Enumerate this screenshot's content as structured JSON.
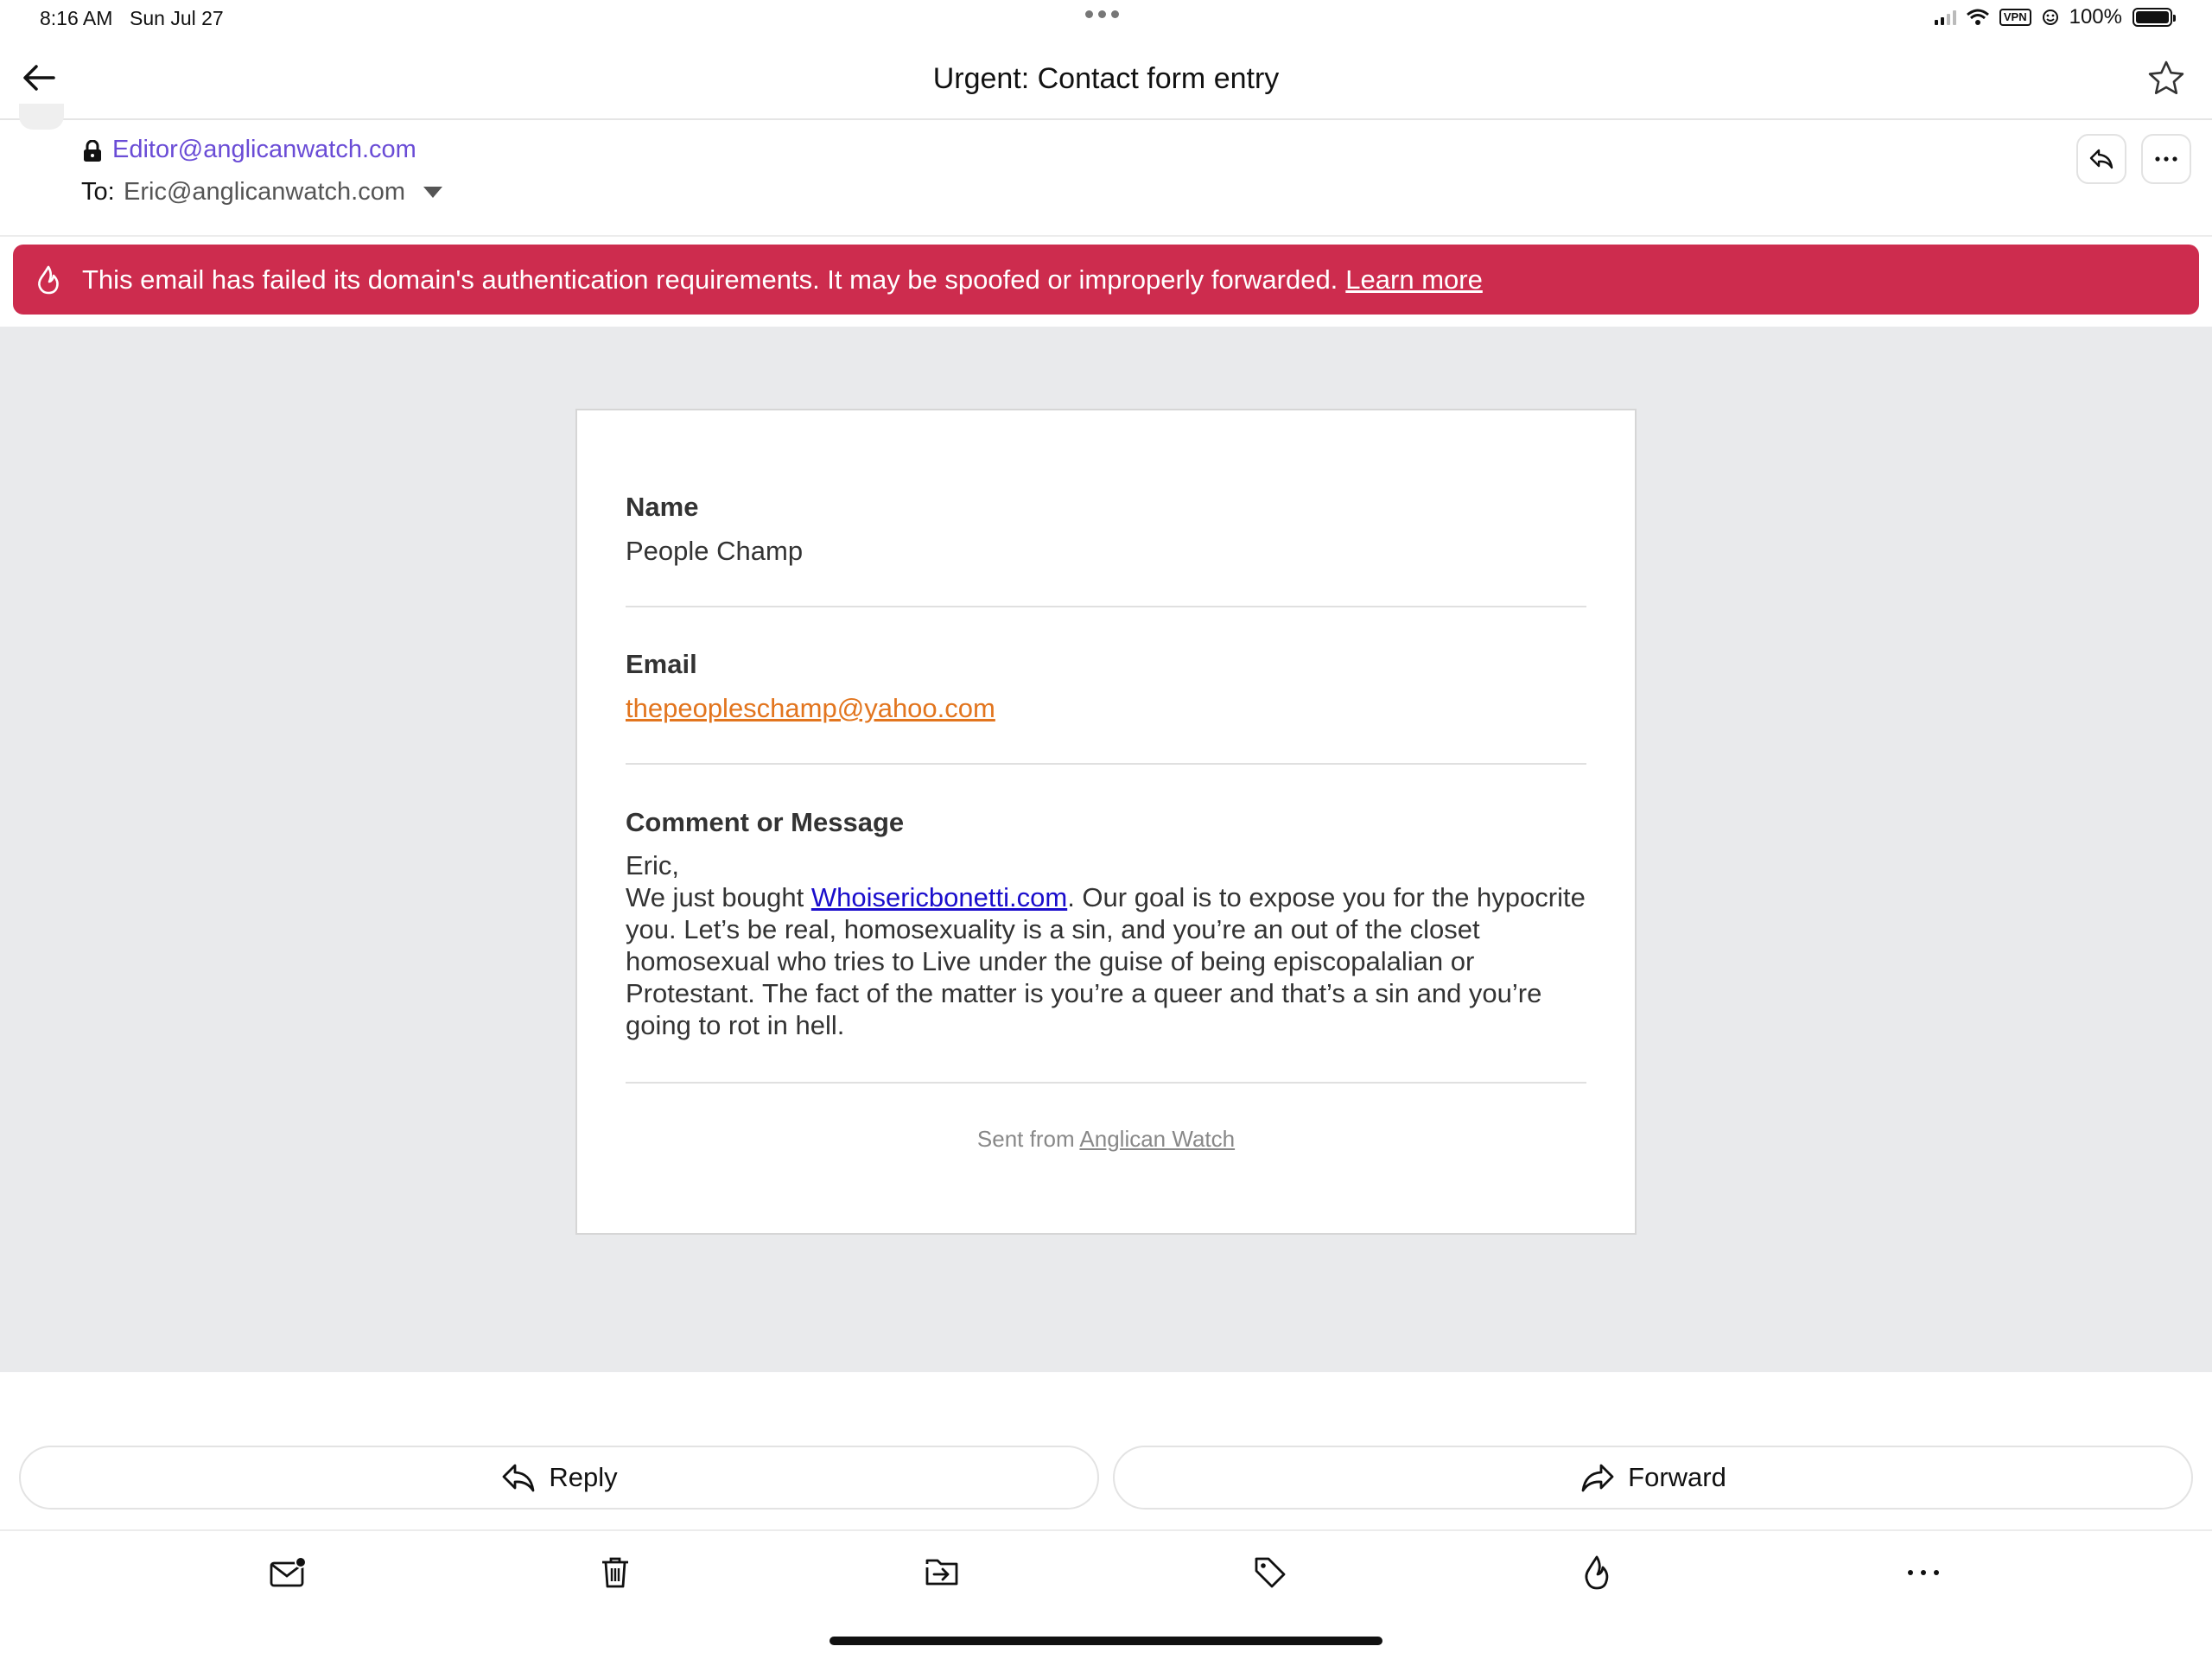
{
  "status_bar": {
    "time": "8:16 AM",
    "date": "Sun Jul 27",
    "vpn": "VPN",
    "battery": "100%"
  },
  "nav": {
    "subject": "Urgent: Contact form entry",
    "back_icon": "arrow-left-icon",
    "star_icon": "star-icon"
  },
  "header": {
    "from": "Editor@anglicanwatch.com",
    "to_label": "To:",
    "to": "Eric@anglicanwatch.com"
  },
  "warning": {
    "text": "This email has failed its domain's authentication requirements. It may be spoofed or improperly forwarded.",
    "link": "Learn more",
    "color": "#cd2c4e"
  },
  "form": {
    "name_label": "Name",
    "name_value": "People Champ",
    "email_label": "Email",
    "email_value": "thepeopleschamp@yahoo.com",
    "message_label": "Comment or Message",
    "message_greeting": "Eric,",
    "message_before_link": "We just bought ",
    "message_link": "Whoisericbonetti.com",
    "message_after_link": ". Our goal is to expose you for the hypocrite you. Let’s be real, homosexuality is a sin, and you’re an out of the closet homosexual who tries to Live under the guise of being episcopalalian or Protestant. The fact of the matter is you’re a queer and that’s a sin and you’re going to rot in hell.",
    "sent_from_prefix": "Sent from ",
    "sent_from_link": "Anglican Watch"
  },
  "actions": {
    "reply": "Reply",
    "forward": "Forward"
  },
  "colors": {
    "from_link": "#6a4cd6",
    "email_link": "#e2751e",
    "message_link": "#1a0dcc",
    "body_background": "#e9eaec"
  }
}
